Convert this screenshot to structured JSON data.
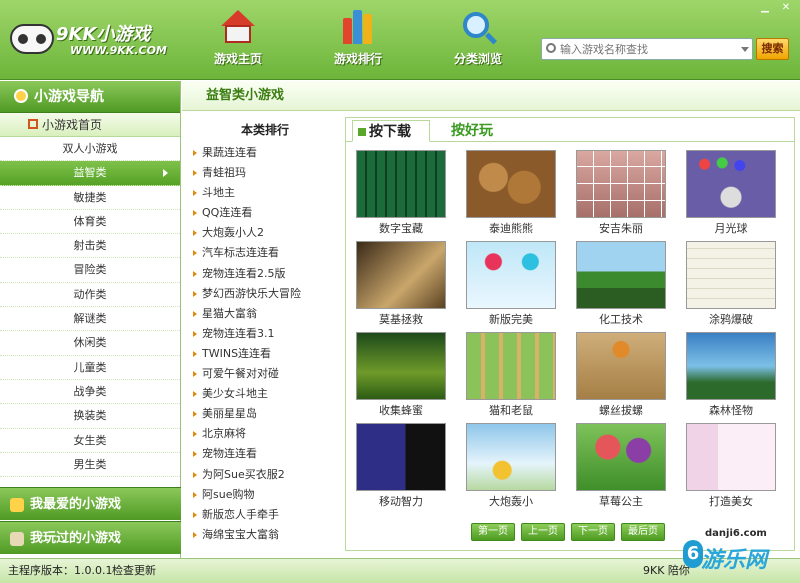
{
  "app": {
    "logo_main": "9KK小游戏",
    "logo_sub": "WWW.9KK.COM"
  },
  "nav": [
    {
      "label": "游戏主页",
      "icon": "home-icon"
    },
    {
      "label": "游戏排行",
      "icon": "ranking-bars-icon"
    },
    {
      "label": "分类浏览",
      "icon": "magnifier-icon"
    }
  ],
  "search": {
    "placeholder": "输入游戏名称查找",
    "button": "搜索"
  },
  "window_controls": [
    "minimize-icon",
    "close-icon"
  ],
  "sidebar": {
    "header": "小游戏导航",
    "home": "小游戏首页",
    "items": [
      "双人小游戏",
      "益智类",
      "敏捷类",
      "体育类",
      "射击类",
      "冒险类",
      "动作类",
      "解谜类",
      "休闲类",
      "儿童类",
      "战争类",
      "换装类",
      "女生类",
      "男生类"
    ],
    "active_index": 1,
    "footer": [
      "我最爱的小游戏",
      "我玩过的小游戏"
    ]
  },
  "main": {
    "title": "益智类小游戏",
    "rank_title": "本类排行",
    "rank_items": [
      "果蔬连连看",
      "青蛙祖玛",
      "斗地主",
      "QQ连连看",
      "大炮轰小人2",
      "汽车标志连连看",
      "宠物连连看2.5版",
      "梦幻西游快乐大冒险",
      "星猫大富翁",
      "宠物连连看3.1",
      "TWINS连连看",
      "可爱午餐对对碰",
      "美少女斗地主",
      "美丽星星岛",
      "北京麻将",
      "宠物连连看",
      "为阿Sue买衣服2",
      "阿sue购物",
      "新版恋人手牵手",
      "海绵宝宝大富翁"
    ],
    "tabs": [
      "按下载",
      "按好玩"
    ],
    "games": [
      "数字宝藏",
      "泰迪熊熊",
      "安吉朱丽",
      "月光球",
      "莫基拯救",
      "新版完美",
      "化工技术",
      "涂鸦爆破",
      "收集蜂蜜",
      "猫和老鼠",
      "螺丝拔螺",
      "森林怪物",
      "移动智力",
      "大炮轰小",
      "草莓公主",
      "打造美女"
    ],
    "pager": [
      "第一页",
      "上一页",
      "下一页",
      "最后页"
    ]
  },
  "status": {
    "version": "主程序版本：1.0.0.1",
    "check": "检查更新",
    "slogan": "9KK 陪你"
  },
  "watermark": {
    "url": "danji6.com",
    "brand": "游乐网",
    "mark": "6"
  }
}
